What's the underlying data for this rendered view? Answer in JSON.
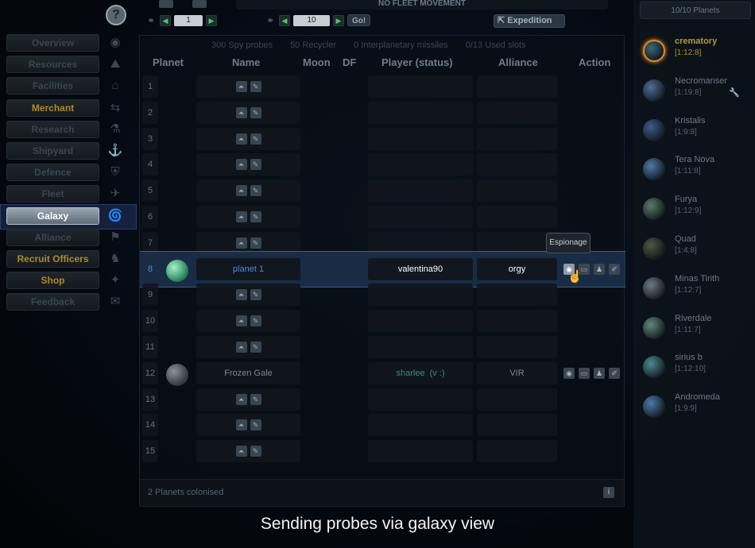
{
  "top": {
    "fleet_status": "NO FLEET MOVEMENT",
    "galaxy_value": "1",
    "system_value": "10",
    "go_label": "Go!",
    "expedition_label": "Expedition"
  },
  "menu": [
    {
      "label": "Overview",
      "icon": "overview-icon",
      "style": "dim"
    },
    {
      "label": "Resources",
      "icon": "resources-icon",
      "style": "dim"
    },
    {
      "label": "Facilities",
      "icon": "facilities-icon",
      "style": "dim"
    },
    {
      "label": "Merchant",
      "icon": "merchant-icon",
      "style": "gold"
    },
    {
      "label": "Research",
      "icon": "research-icon",
      "style": "dim"
    },
    {
      "label": "Shipyard",
      "icon": "shipyard-icon",
      "style": "dim"
    },
    {
      "label": "Defence",
      "icon": "defence-icon",
      "style": "dim"
    },
    {
      "label": "Fleet",
      "icon": "fleet-icon",
      "style": "dim"
    },
    {
      "label": "Galaxy",
      "icon": "galaxy-icon",
      "style": "active"
    },
    {
      "label": "Alliance",
      "icon": "alliance-icon",
      "style": "dim"
    },
    {
      "label": "Recruit Officers",
      "icon": "officers-icon",
      "style": "gold"
    },
    {
      "label": "Shop",
      "icon": "shop-icon",
      "style": "gold"
    },
    {
      "label": "Feedback",
      "icon": "feedback-icon",
      "style": "dim"
    }
  ],
  "summary": {
    "spy_probes": "300 Spy probes",
    "recycler": "50 Recycler",
    "missiles": "0 Interplanetary missiles",
    "slots": "0/13 Used slots"
  },
  "headers": {
    "planet": "Planet",
    "name": "Name",
    "moon": "Moon",
    "df": "DF",
    "player": "Player (status)",
    "alliance": "Alliance",
    "action": "Action"
  },
  "rows": [
    {
      "pos": "1",
      "name": "",
      "player": "",
      "alliance": ""
    },
    {
      "pos": "2",
      "name": "",
      "player": "",
      "alliance": ""
    },
    {
      "pos": "3",
      "name": "",
      "player": "",
      "alliance": ""
    },
    {
      "pos": "4",
      "name": "",
      "player": "",
      "alliance": ""
    },
    {
      "pos": "5",
      "name": "",
      "player": "",
      "alliance": ""
    },
    {
      "pos": "6",
      "name": "",
      "player": "",
      "alliance": ""
    },
    {
      "pos": "7",
      "name": "",
      "player": "",
      "alliance": ""
    },
    {
      "pos": "8",
      "name": "planet 1",
      "player": "valentina90",
      "alliance": "orgy",
      "highlight": true
    },
    {
      "pos": "9",
      "name": "",
      "player": "",
      "alliance": ""
    },
    {
      "pos": "10",
      "name": "",
      "player": "",
      "alliance": ""
    },
    {
      "pos": "11",
      "name": "",
      "player": "",
      "alliance": ""
    },
    {
      "pos": "12",
      "name": "Frozen Gale",
      "player": "sharlee",
      "player_status": "(v :)",
      "alliance": "VIR"
    },
    {
      "pos": "13",
      "name": "",
      "player": "",
      "alliance": ""
    },
    {
      "pos": "14",
      "name": "",
      "player": "",
      "alliance": ""
    },
    {
      "pos": "15",
      "name": "",
      "player": "",
      "alliance": ""
    }
  ],
  "tooltip": "Espionage",
  "footer": "2 Planets colonised",
  "planet_count": "10/10 Planets",
  "planets": [
    {
      "name": "crematory",
      "coords": "[1:12:8]",
      "active": true,
      "color": "#3b6a7d"
    },
    {
      "name": "Necromanser",
      "coords": "[1:19:8]",
      "color": "#4d6f93"
    },
    {
      "name": "Kristalis",
      "coords": "[1:9:8]",
      "color": "#3f5c8a"
    },
    {
      "name": "Tera Nova",
      "coords": "[1:11:8]",
      "color": "#4f7aa3"
    },
    {
      "name": "Furya",
      "coords": "[1:12:9]",
      "color": "#5b7a6a"
    },
    {
      "name": "Quad",
      "coords": "[1:4:8]",
      "color": "#4a5a44"
    },
    {
      "name": "Minas Tirith",
      "coords": "[1:12:7]",
      "color": "#6e7a82"
    },
    {
      "name": "Riverdale",
      "coords": "[1:11:7]",
      "color": "#5e8a7a"
    },
    {
      "name": "sirius b",
      "coords": "[1:12:10]",
      "color": "#4e8a8f"
    },
    {
      "name": "Andromeda",
      "coords": "[1:9:9]",
      "color": "#4f7aa8"
    }
  ],
  "caption": "Sending probes via galaxy view"
}
